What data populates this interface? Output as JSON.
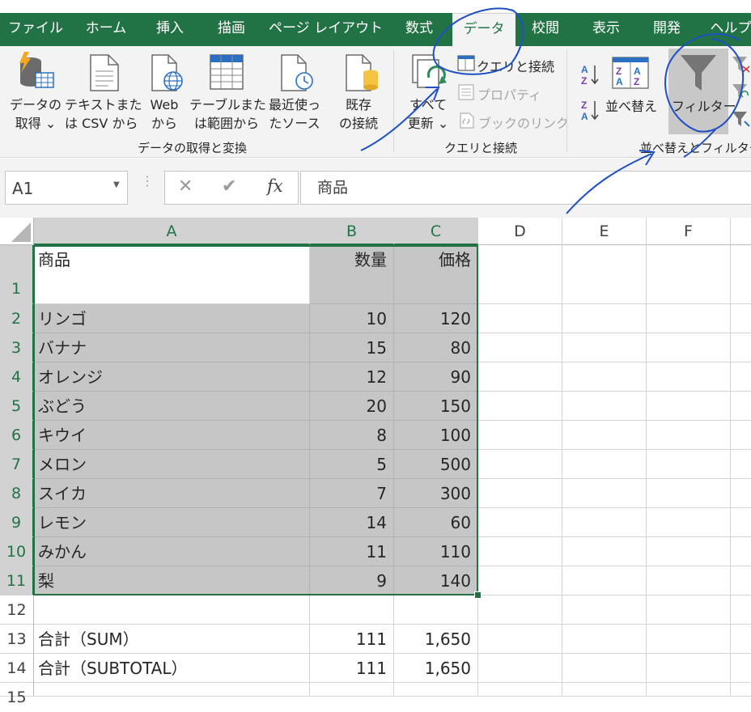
{
  "tabs": [
    {
      "label": "ファイル",
      "active": false
    },
    {
      "label": "ホーム",
      "active": false
    },
    {
      "label": "挿入",
      "active": false
    },
    {
      "label": "描画",
      "active": false
    },
    {
      "label": "ページ レイアウト",
      "active": false
    },
    {
      "label": "数式",
      "active": false
    },
    {
      "label": "データ",
      "active": true
    },
    {
      "label": "校閲",
      "active": false
    },
    {
      "label": "表示",
      "active": false
    },
    {
      "label": "開発",
      "active": false
    },
    {
      "label": "ヘルプ",
      "active": false
    }
  ],
  "ribbon": {
    "get_data": {
      "line1": "データの",
      "line2": "取得 ⌄"
    },
    "text_csv": {
      "line1": "テキストまた",
      "line2": "は CSV から"
    },
    "web": {
      "line1": "Web",
      "line2": "から"
    },
    "table_range": {
      "line1": "テーブルまた",
      "line2": "は範囲から"
    },
    "recent_sources": {
      "line1": "最近使っ",
      "line2": "たソース"
    },
    "existing_connections": {
      "line1": "既存",
      "line2": "の接続"
    },
    "group_get_transform": "データの取得と変換",
    "refresh_all": {
      "line1": "すべて",
      "line2": "更新 ⌄"
    },
    "queries_connections": "クエリと接続",
    "properties": "プロパティ",
    "edit_links": "ブックのリンク",
    "group_queries": "クエリと接続",
    "sort": "並べ替え",
    "filter": "フィルター",
    "group_sort_filter": "並べ替えとフィルター"
  },
  "formula_bar": {
    "name_box": "A1",
    "cancel_symbol": "✕",
    "enter_symbol": "✔",
    "fx_symbol": "fx",
    "content": "商品"
  },
  "columns": [
    "A",
    "B",
    "C",
    "D",
    "E",
    "F"
  ],
  "rows": [
    {
      "num": "1",
      "a": "商品",
      "b": "数量",
      "c": "価格"
    },
    {
      "num": "2",
      "a": "リンゴ",
      "b": "10",
      "c": "120"
    },
    {
      "num": "3",
      "a": "バナナ",
      "b": "15",
      "c": "80"
    },
    {
      "num": "4",
      "a": "オレンジ",
      "b": "12",
      "c": "90"
    },
    {
      "num": "5",
      "a": "ぶどう",
      "b": "20",
      "c": "150"
    },
    {
      "num": "6",
      "a": "キウイ",
      "b": "8",
      "c": "100"
    },
    {
      "num": "7",
      "a": "メロン",
      "b": "5",
      "c": "500"
    },
    {
      "num": "8",
      "a": "スイカ",
      "b": "7",
      "c": "300"
    },
    {
      "num": "9",
      "a": "レモン",
      "b": "14",
      "c": "60"
    },
    {
      "num": "10",
      "a": "みかん",
      "b": "11",
      "c": "110"
    },
    {
      "num": "11",
      "a": "梨",
      "b": "9",
      "c": "140"
    },
    {
      "num": "12",
      "a": "",
      "b": "",
      "c": ""
    },
    {
      "num": "13",
      "a": "合計（SUM）",
      "b": "111",
      "c": "1,650"
    },
    {
      "num": "14",
      "a": "合計（SUBTOTAL）",
      "b": "111",
      "c": "1,650"
    },
    {
      "num": "15",
      "a": "",
      "b": "",
      "c": ""
    }
  ],
  "colors": {
    "excel_green": "#217346",
    "selection_gray": "#c6c6c6",
    "annotation_blue": "#1f4fc4"
  }
}
